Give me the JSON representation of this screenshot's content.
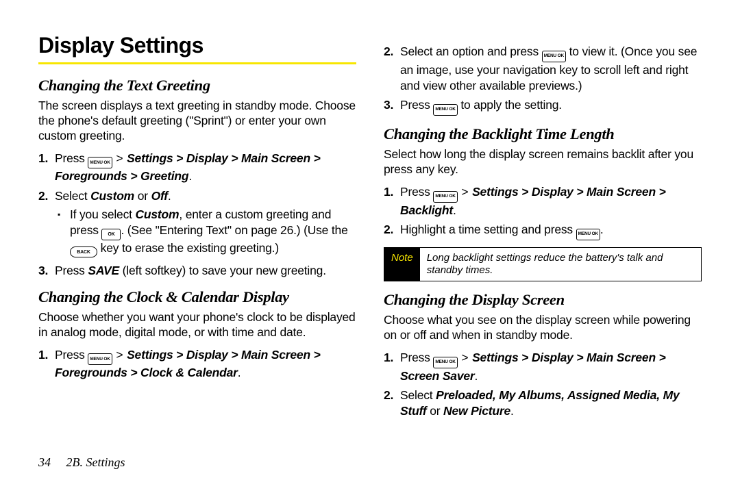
{
  "title": "Display Settings",
  "left": {
    "sub1": "Changing the Text Greeting",
    "p1": "The screen displays a text greeting in standby mode. Choose the phone's default greeting (\"Sprint\") or enter your own custom greeting.",
    "step1_a": "Press ",
    "step1_path": "Settings > Display > Main Screen > Foregrounds > Greeting",
    "step2_a": "Select ",
    "step2_b": "Custom",
    "step2_c": " or ",
    "step2_d": "Off",
    "bullet_a": "If you select ",
    "bullet_b": "Custom",
    "bullet_c": ", enter a custom greeting and press ",
    "bullet_d": ". (See \"Entering Text\" on page 26.) (Use the ",
    "bullet_e": " key to erase the existing greeting.)",
    "step3_a": "Press ",
    "step3_b": "SAVE",
    "step3_c": " (left softkey) to save your new greeting.",
    "sub2": "Changing the Clock & Calendar Display",
    "p2": "Choose whether you want your phone's clock to be displayed in analog mode, digital mode, or with time and date.",
    "step4_a": "Press ",
    "step4_path": "Settings > Display > Main Screen > Foregrounds > Clock & Calendar"
  },
  "right": {
    "step1_a": "Select an option and press ",
    "step1_b": " to view it. (Once you see an image, use your navigation key to scroll left and right and view other available previews.)",
    "step2_a": "Press ",
    "step2_b": " to apply the setting.",
    "sub1": "Changing the Backlight Time Length",
    "p1": "Select how long the display screen remains backlit after you press any key.",
    "step3_a": "Press ",
    "step3_path": "Settings > Display > Main Screen > Backlight",
    "step4_a": "Highlight a time setting and press ",
    "note_label": "Note",
    "note_text": "Long backlight settings reduce the battery's talk and standby times.",
    "sub2": "Changing the Display Screen",
    "p2": "Choose what you see on the display screen while powering on or off and when in standby mode.",
    "step5_a": "Press ",
    "step5_path": "Settings > Display > Main Screen > Screen Saver",
    "step6_a": "Select ",
    "step6_b": "Preloaded, My Albums, Assigned Media, My Stuff",
    "step6_c": " or ",
    "step6_d": "New Picture"
  },
  "keys": {
    "menu_ok": "MENU\nOK",
    "ok": "OK",
    "back": "BACK"
  },
  "footer": {
    "page": "34",
    "section": "2B. Settings"
  }
}
